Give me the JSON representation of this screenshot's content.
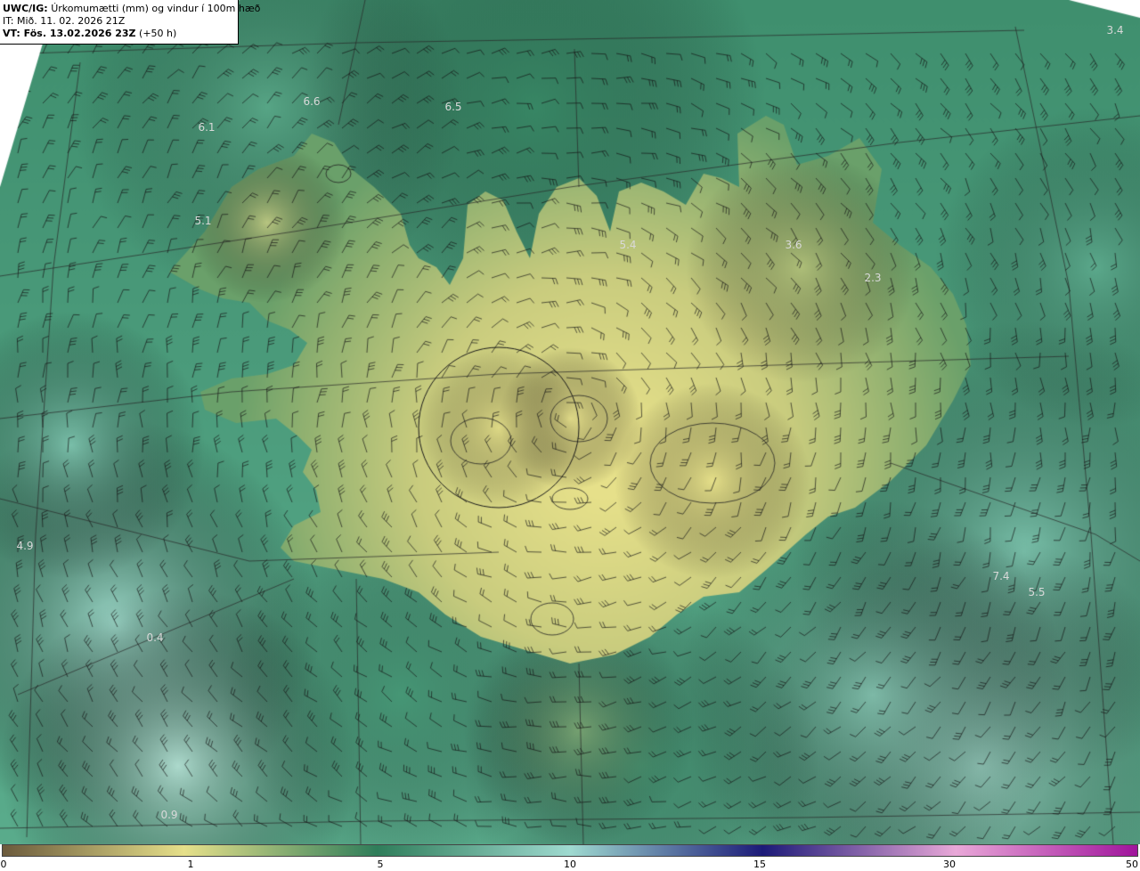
{
  "header": {
    "model": "UWC/IG:",
    "title": "Úrkomumætti (mm) og vindur í 100m hæð",
    "init_time": "IT: Mið. 11. 02. 2026 21Z",
    "valid_prefix": "VT: Fös. 13.02.2026 23Z",
    "valid_suffix": "(+50 h)"
  },
  "value_labels": [
    "3.4",
    "6.6",
    "6.5",
    "6.1",
    "5.1",
    "5.4",
    "3.6",
    "2.3",
    "4.9",
    "7.4",
    "5.5",
    "0.4",
    "0.9"
  ],
  "colorbar": {
    "ticks": [
      "0",
      "1",
      "5",
      "10",
      "15",
      "30",
      "50"
    ],
    "colors": {
      "dry_brown": "#6b5a3c",
      "light_yellow": "#e6e08a",
      "sea_green": "#2f7d5a",
      "light_teal": "#9fdad0",
      "navy": "#1c1a78",
      "pink": "#e9a8d8",
      "magenta": "#a0159c"
    }
  }
}
